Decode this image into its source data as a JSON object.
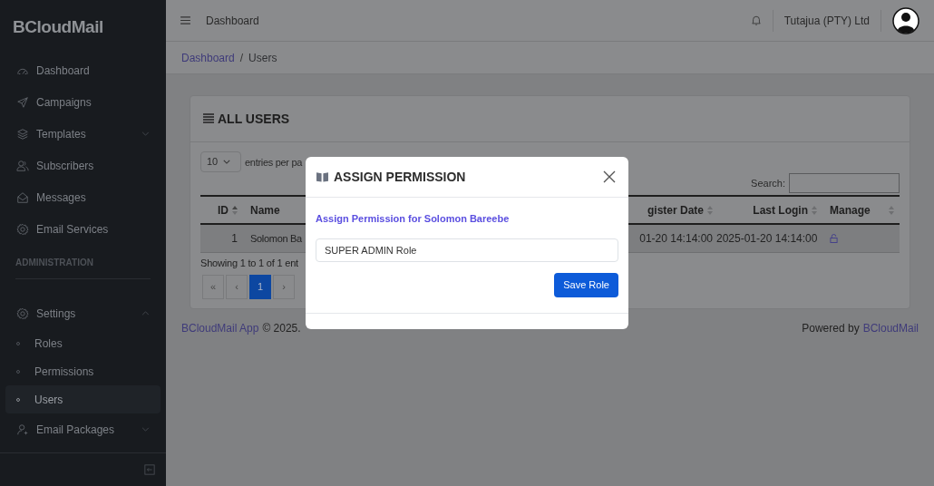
{
  "sidebar": {
    "logo": "BCloudMail",
    "items": [
      {
        "label": "Dashboard",
        "kind": "gauge",
        "has_caret": false
      },
      {
        "label": "Campaigns",
        "kind": "send",
        "has_caret": false
      },
      {
        "label": "Templates",
        "kind": "layers",
        "has_caret": true
      },
      {
        "label": "Subscribers",
        "kind": "users",
        "has_caret": false
      },
      {
        "label": "Messages",
        "kind": "mail",
        "has_caret": false
      },
      {
        "label": "Email Services",
        "kind": "gear",
        "has_caret": false
      }
    ],
    "section_title": "ADMINISTRATION",
    "admin_items": [
      {
        "label": "Settings",
        "kind": "gear",
        "expanded": true,
        "children": [
          {
            "label": "Roles",
            "selected": false
          },
          {
            "label": "Permissions",
            "selected": false
          },
          {
            "label": "Users",
            "selected": true
          }
        ]
      },
      {
        "label": "Email Packages",
        "kind": "user-plus",
        "expanded": false
      }
    ]
  },
  "topbar": {
    "title": "Dashboard",
    "company": "Tutajua (PTY) Ltd"
  },
  "breadcrumb": {
    "separator": "/",
    "items": [
      "Dashboard",
      "Users"
    ]
  },
  "card": {
    "title": "ALL USERS",
    "page_size": "10",
    "page_size_label": "entries per pa",
    "search_label": "Search:",
    "columns": [
      "ID",
      "Name",
      "gister Date",
      "Last Login",
      "Manage"
    ],
    "rows": [
      [
        "1",
        "Solomon Ba",
        "01-20 14:14:00",
        "2025-01-20 14:14:00"
      ]
    ],
    "info": "Showing 1 to 1 of 1 ent",
    "pagination": [
      {
        "label": "«",
        "selected": false
      },
      {
        "label": "‹",
        "selected": false
      },
      {
        "label": "1",
        "selected": true
      },
      {
        "label": "›",
        "selected": false
      }
    ]
  },
  "footer": {
    "brand": "BCloudMail App",
    "copyright": "© 2025.",
    "powered": "Powered by",
    "powered_link": "BCloudMail"
  },
  "modal": {
    "title": "ASSIGN PERMISSION",
    "subtitle": "Assign Permission for Solomon Bareebe",
    "role_value": "SUPER ADMIN Role",
    "save_button": "Save Role"
  }
}
